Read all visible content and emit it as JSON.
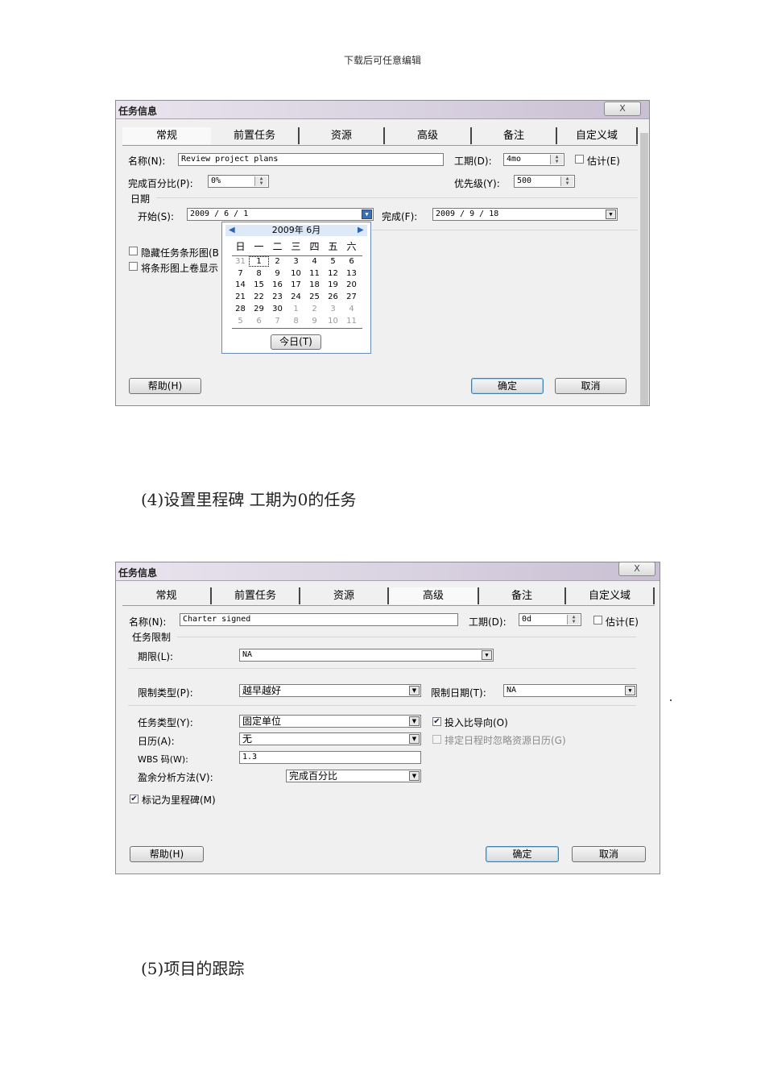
{
  "header": {
    "text": "下载后可任意编辑"
  },
  "dialog1": {
    "title": "任务信息",
    "close": "X",
    "tabs": [
      "常规",
      "前置任务",
      "资源",
      "高级",
      "备注",
      "自定义域"
    ],
    "name_label": "名称(N):",
    "name_value": "Review project plans",
    "duration_label": "工期(D):",
    "duration_value": "4mo",
    "estimated_label": "估计(E)",
    "percent_label": "完成百分比(P):",
    "percent_value": "0%",
    "priority_label": "优先级(Y):",
    "priority_value": "500",
    "dates_label": "日期",
    "start_label": "开始(S):",
    "start_value": "2009 / 6 / 1",
    "finish_label": "完成(F):",
    "finish_value": "2009 / 9 / 18",
    "hide_bar_label": "隐藏任务条形图(B",
    "rollup_label": "将条形图上卷显示",
    "help_label": "帮助(H)",
    "ok_label": "确定",
    "cancel_label": "取消",
    "calendar": {
      "month_label": "2009年 6月",
      "weekdays": [
        "日",
        "一",
        "二",
        "三",
        "四",
        "五",
        "六"
      ],
      "weeks": [
        [
          "31",
          "1",
          "2",
          "3",
          "4",
          "5",
          "6"
        ],
        [
          "7",
          "8",
          "9",
          "10",
          "11",
          "12",
          "13"
        ],
        [
          "14",
          "15",
          "16",
          "17",
          "18",
          "19",
          "20"
        ],
        [
          "21",
          "22",
          "23",
          "24",
          "25",
          "26",
          "27"
        ],
        [
          "28",
          "29",
          "30",
          "1",
          "2",
          "3",
          "4"
        ],
        [
          "5",
          "6",
          "7",
          "8",
          "9",
          "10",
          "11"
        ]
      ],
      "selected_day": "1",
      "today_label": "今日(T)"
    }
  },
  "caption1": "(4)设置里程碑 工期为0的任务",
  "dialog2": {
    "title": "任务信息",
    "close": "X",
    "tabs": [
      "常规",
      "前置任务",
      "资源",
      "高级",
      "备注",
      "自定义域"
    ],
    "active_tab": "高级",
    "name_label": "名称(N):",
    "name_value": "Charter signed",
    "duration_label": "工期(D):",
    "duration_value": "0d",
    "estimated_label": "估计(E)",
    "constraint_group": "任务限制",
    "deadline_label": "期限(L):",
    "deadline_value": "NA",
    "constraint_type_label": "限制类型(P):",
    "constraint_type_value": "越早越好",
    "constraint_date_label": "限制日期(T):",
    "constraint_date_value": "NA",
    "task_type_label": "任务类型(Y):",
    "task_type_value": "固定单位",
    "effort_driven_label": "投入比导向(O)",
    "calendar_label": "日历(A):",
    "calendar_value": "无",
    "ignore_resource_label": "排定日程时忽略资源日历(G)",
    "wbs_label": "WBS 码(W):",
    "wbs_value": "1.3",
    "earned_value_label": "盈余分析方法(V):",
    "earned_value_value": "完成百分比",
    "milestone_label": "标记为里程碑(M)",
    "help_label": "帮助(H)",
    "ok_label": "确定",
    "cancel_label": "取消"
  },
  "caption2": "(5)项目的跟踪"
}
